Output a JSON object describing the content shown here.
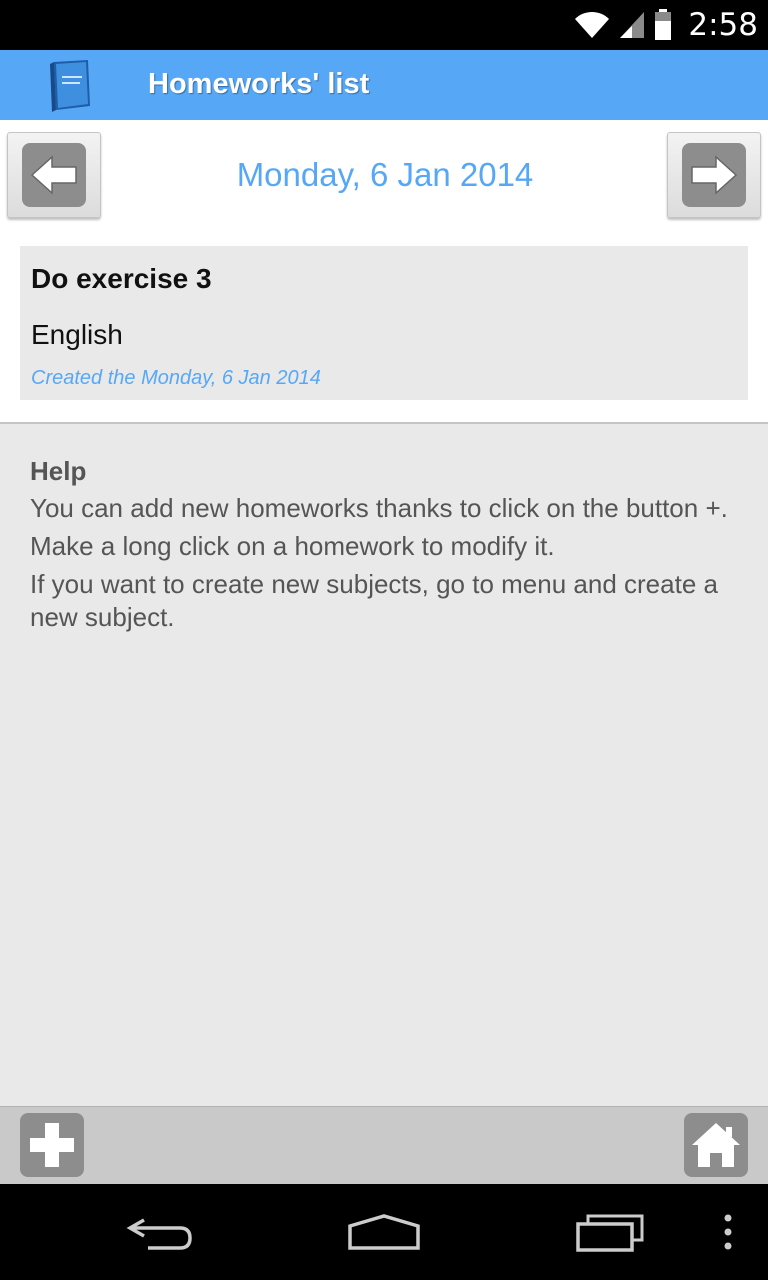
{
  "status_bar": {
    "time": "2:58",
    "icons": [
      "wifi-icon",
      "cell-signal-icon",
      "battery-icon"
    ]
  },
  "action_bar": {
    "title": "Homeworks' list",
    "app_icon": "book-icon"
  },
  "date_nav": {
    "date": "Monday, 6 Jan 2014",
    "prev_icon": "arrow-left-icon",
    "next_icon": "arrow-right-icon"
  },
  "homeworks": [
    {
      "title": "Do exercise 3",
      "subject": "English",
      "created": "Created the Monday, 6 Jan 2014"
    }
  ],
  "help": {
    "title": "Help",
    "lines": [
      "You can add new homeworks thanks to click on the button +.",
      "Make a long click on a homework to modify it.",
      "If you want to create new subjects, go to menu and create a new subject."
    ]
  },
  "bottom_bar": {
    "add_icon": "plus-icon",
    "home_icon": "home-icon"
  },
  "system_nav": [
    "back-icon",
    "home-outline-icon",
    "recent-apps-icon",
    "overflow-menu-icon"
  ],
  "colors": {
    "accent": "#56a8f6",
    "status_bar": "#000000",
    "background": "#e9e9e9",
    "button_gray": "#8d8d8d"
  }
}
